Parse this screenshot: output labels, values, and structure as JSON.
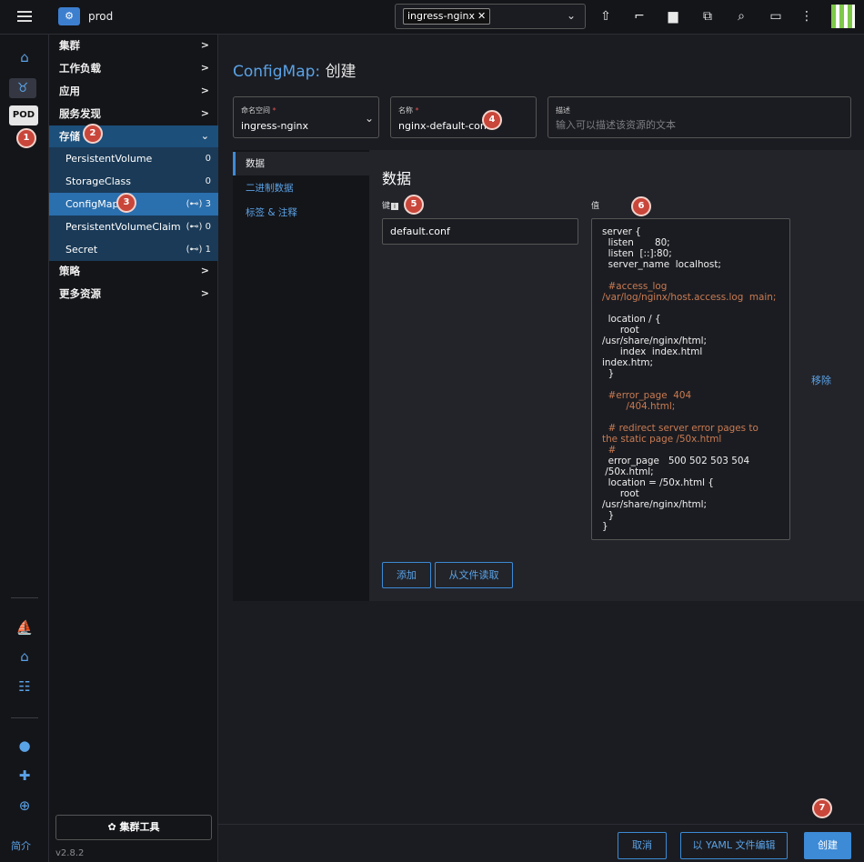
{
  "header": {
    "cluster_name": "prod",
    "namespace_chip": "ingress-nginx"
  },
  "rail": {
    "pod_label": "POD",
    "intro": "简介"
  },
  "sidebar": {
    "menus": [
      {
        "label": "集群",
        "arrow": ">"
      },
      {
        "label": "工作负载",
        "arrow": ">"
      },
      {
        "label": "应用",
        "arrow": ">"
      },
      {
        "label": "服务发现",
        "arrow": ">"
      },
      {
        "label": "存储",
        "arrow": "⌄"
      },
      {
        "label": "策略",
        "arrow": ">"
      },
      {
        "label": "更多资源",
        "arrow": ">"
      }
    ],
    "storage_items": [
      {
        "label": "PersistentVolume",
        "count": "0"
      },
      {
        "label": "StorageClass",
        "count": "0"
      },
      {
        "label": "ConfigMap",
        "count": "3"
      },
      {
        "label": "PersistentVolumeClaim",
        "count": "0"
      },
      {
        "label": "Secret",
        "count": "1"
      }
    ],
    "tools_button": "集群工具",
    "version": "v2.8.2"
  },
  "main": {
    "title_resource": "ConfigMap:",
    "title_action": "创建",
    "namespace": {
      "label": "命名空间",
      "value": "ingress-nginx"
    },
    "name": {
      "label": "名称",
      "value": "nginx-default-conf"
    },
    "description": {
      "label": "描述",
      "placeholder": "输入可以描述该资源的文本"
    },
    "tabs": [
      "数据",
      "二进制数据",
      "标签 & 注释"
    ],
    "data_heading": "数据",
    "key_label": "键",
    "value_label": "值",
    "key_value": "default.conf",
    "remove": "移除",
    "add_button": "添加",
    "read_file_button": "从文件读取"
  },
  "code_lines": [
    "server {",
    "  listen       80;",
    "  listen  [::]:80;",
    "  server_name  localhost;",
    "",
    "  #access_log",
    "/var/log/nginx/host.access.log  main;",
    "",
    "  location / {",
    "      root",
    "/usr/share/nginx/html;",
    "      index  index.html",
    "index.htm;",
    "  }",
    "",
    "  #error_page  404",
    "        /404.html;",
    "",
    "  # redirect server error pages to",
    "the static page /50x.html",
    "  #",
    "  error_page   500 502 503 504",
    " /50x.html;",
    "  location = /50x.html {",
    "      root",
    "/usr/share/nginx/html;",
    "  }",
    "}"
  ],
  "footer": {
    "cancel": "取消",
    "yaml": "以 YAML 文件编辑",
    "create": "创建"
  },
  "badges": [
    "1",
    "2",
    "3",
    "4",
    "5",
    "6",
    "7"
  ],
  "colors": {
    "accent": "#3d8ad6",
    "badge": "#c9463a",
    "active": "#2a6fae"
  }
}
